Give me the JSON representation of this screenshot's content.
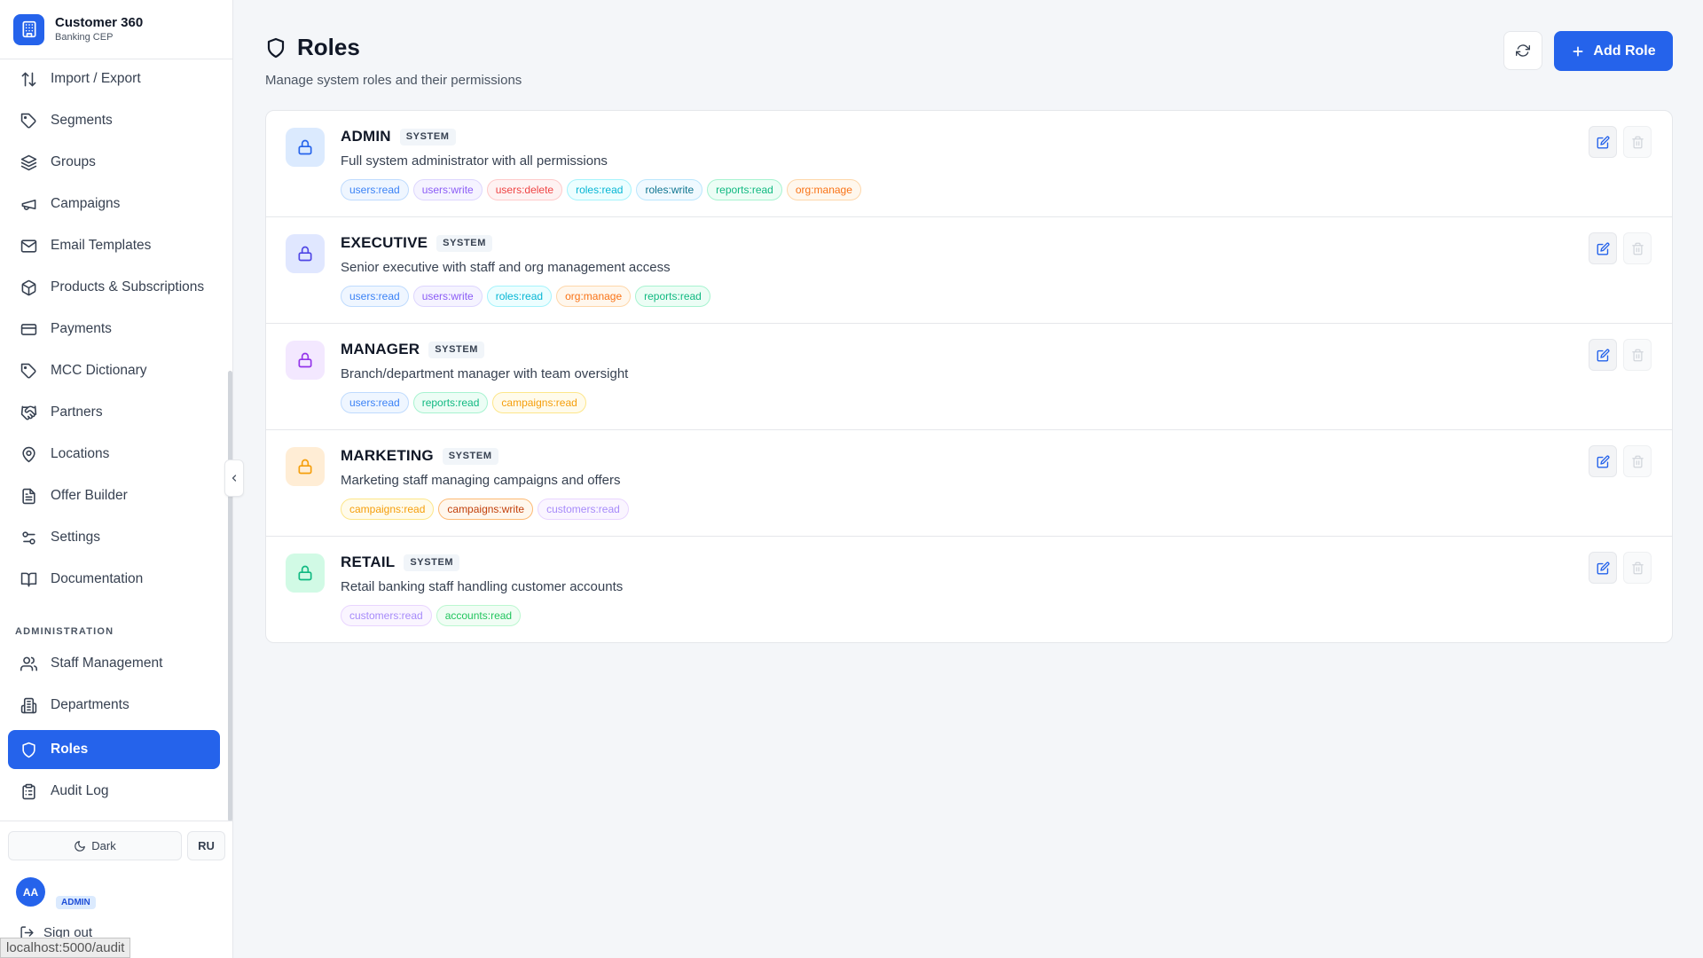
{
  "app": {
    "title": "Customer 360",
    "subtitle": "Banking CEP"
  },
  "sidebar": {
    "items": [
      {
        "label": "Import / Export",
        "icon": "arrows-updown-icon"
      },
      {
        "label": "Segments",
        "icon": "tag-icon"
      },
      {
        "label": "Groups",
        "icon": "layers-icon"
      },
      {
        "label": "Campaigns",
        "icon": "megaphone-icon"
      },
      {
        "label": "Email Templates",
        "icon": "mail-icon"
      },
      {
        "label": "Products & Subscriptions",
        "icon": "package-icon"
      },
      {
        "label": "Payments",
        "icon": "credit-card-icon"
      },
      {
        "label": "MCC Dictionary",
        "icon": "tag-icon"
      },
      {
        "label": "Partners",
        "icon": "handshake-icon"
      },
      {
        "label": "Locations",
        "icon": "map-pin-icon"
      },
      {
        "label": "Offer Builder",
        "icon": "file-text-icon"
      },
      {
        "label": "Settings",
        "icon": "sliders-icon"
      },
      {
        "label": "Documentation",
        "icon": "book-icon"
      }
    ],
    "admin_section_label": "ADMINISTRATION",
    "admin_items": [
      {
        "label": "Staff Management",
        "icon": "users-icon"
      },
      {
        "label": "Departments",
        "icon": "building-icon"
      },
      {
        "label": "Roles",
        "icon": "shield-icon",
        "active": true
      },
      {
        "label": "Audit Log",
        "icon": "clipboard-icon"
      }
    ],
    "theme_label": "Dark",
    "lang_label": "RU",
    "user": {
      "avatar_initials": "AA",
      "role_badge": "ADMIN"
    },
    "signout_label": "Sign out"
  },
  "status_url": "localhost:5000/audit",
  "page": {
    "title": "Roles",
    "subtitle": "Manage system roles and their permissions",
    "add_button_label": "Add Role"
  },
  "roles": [
    {
      "name": "ADMIN",
      "badge": "SYSTEM",
      "description": "Full system administrator with all permissions",
      "icon_bg": "#dbeafe",
      "icon_color": "#2563eb",
      "permissions": [
        "users:read",
        "users:write",
        "users:delete",
        "roles:read",
        "roles:write",
        "reports:read",
        "org:manage"
      ]
    },
    {
      "name": "EXECUTIVE",
      "badge": "SYSTEM",
      "description": "Senior executive with staff and org management access",
      "icon_bg": "#e0e7ff",
      "icon_color": "#4f46e5",
      "permissions": [
        "users:read",
        "users:write",
        "roles:read",
        "org:manage",
        "reports:read"
      ]
    },
    {
      "name": "MANAGER",
      "badge": "SYSTEM",
      "description": "Branch/department manager with team oversight",
      "icon_bg": "#f3e8ff",
      "icon_color": "#9333ea",
      "permissions": [
        "users:read",
        "reports:read",
        "campaigns:read"
      ]
    },
    {
      "name": "MARKETING",
      "badge": "SYSTEM",
      "description": "Marketing staff managing campaigns and offers",
      "icon_bg": "#ffedd5",
      "icon_color": "#f59e0b",
      "permissions": [
        "campaigns:read",
        "campaigns:write",
        "customers:read"
      ]
    },
    {
      "name": "RETAIL",
      "badge": "SYSTEM",
      "description": "Retail banking staff handling customer accounts",
      "icon_bg": "#d1fae5",
      "icon_color": "#10b981",
      "permissions": [
        "customers:read",
        "accounts:read"
      ]
    }
  ],
  "perm_colors": {
    "users:read": {
      "bg": "#eff6ff",
      "border": "#bfdbfe",
      "text": "#3b82f6"
    },
    "users:write": {
      "bg": "#f5f3ff",
      "border": "#ddd6fe",
      "text": "#8b5cf6"
    },
    "users:delete": {
      "bg": "#fef2f2",
      "border": "#fecaca",
      "text": "#ef4444"
    },
    "roles:read": {
      "bg": "#ecfeff",
      "border": "#a5f3fc",
      "text": "#06b6d4"
    },
    "roles:write": {
      "bg": "#f0f9ff",
      "border": "#bae6fd",
      "text": "#0e7490"
    },
    "reports:read": {
      "bg": "#ecfdf5",
      "border": "#a7f3d0",
      "text": "#10b981"
    },
    "org:manage": {
      "bg": "#fff7ed",
      "border": "#fed7aa",
      "text": "#f97316"
    },
    "campaigns:read": {
      "bg": "#fffbeb",
      "border": "#fde68a",
      "text": "#f59e0b"
    },
    "campaigns:write": {
      "bg": "#fff7ed",
      "border": "#fdba74",
      "text": "#c2410c"
    },
    "customers:read": {
      "bg": "#faf5ff",
      "border": "#e9d5ff",
      "text": "#a78bfa"
    },
    "accounts:read": {
      "bg": "#f0fdf4",
      "border": "#bbf7d0",
      "text": "#22c55e"
    }
  }
}
